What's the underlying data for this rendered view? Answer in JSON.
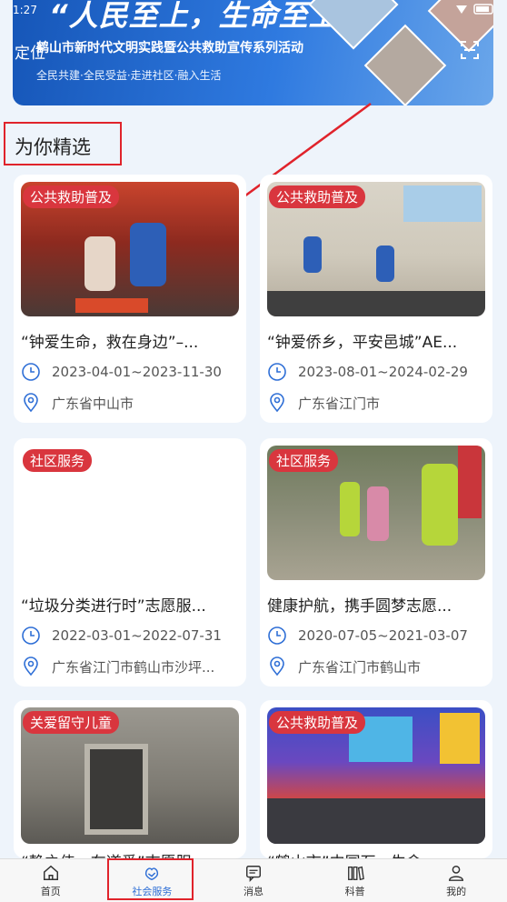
{
  "status_bar": {
    "time": "1:27"
  },
  "banner": {
    "title": "“人民至上，生命至上”",
    "subtitle": "鹤山市新时代文明实践暨公共救助宣传系列活动",
    "slogan": "全民共建·全民受益·走进社区·融入生活",
    "location_label": "定位"
  },
  "section": {
    "title": "为你精选"
  },
  "cards": [
    {
      "badge": "公共救助普及",
      "title": "“钟爱生命，救在身边”–...",
      "date": "2023-04-01~2023-11-30",
      "location": "广东省中山市"
    },
    {
      "badge": "公共救助普及",
      "title": "“钟爱侨乡，平安邑城”AE...",
      "date": "2023-08-01~2024-02-29",
      "location": "广东省江门市"
    },
    {
      "badge": "社区服务",
      "title": "“垃圾分类进行时”志愿服...",
      "date": "2022-03-01~2022-07-31",
      "location": "广东省江门市鹤山市沙坪..."
    },
    {
      "badge": "社区服务",
      "title": "健康护航，携手圆梦志愿...",
      "date": "2020-07-05~2021-03-07",
      "location": "广东省江门市鹤山市"
    },
    {
      "badge": "关爱留守儿童",
      "title": "“静之伟，在道爱”志愿服..."
    },
    {
      "badge": "公共救助普及",
      "title": "“鹤山市”中国石...生命..."
    }
  ],
  "nav": [
    {
      "label": "首页",
      "icon": "home-icon"
    },
    {
      "label": "社会服务",
      "icon": "social-service-icon"
    },
    {
      "label": "消息",
      "icon": "message-icon"
    },
    {
      "label": "科普",
      "icon": "science-icon"
    },
    {
      "label": "我的",
      "icon": "profile-icon"
    }
  ],
  "colors": {
    "accent": "#2f6fd6",
    "badge": "#d9363e",
    "annotation": "#e0232b"
  }
}
